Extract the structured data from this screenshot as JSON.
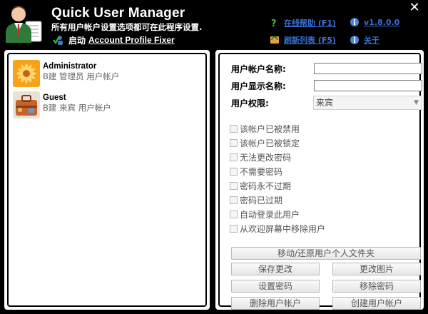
{
  "header": {
    "title": "Quick User Manager",
    "subtitle": "所有用户帐户设置选项都可在此程序设置.",
    "startup_label": "启动",
    "startup_link": "Account Profile Fixer",
    "links": {
      "help": "在线帮助 (F1)",
      "version": "v1.8.0.0",
      "refresh": "刷新列表 (F5)",
      "about": "关于"
    },
    "close": "✕"
  },
  "users": [
    {
      "name": "Administrator",
      "desc": "B建 管理员 用户帐户",
      "avatar": "flower-icon"
    },
    {
      "name": "Guest",
      "desc": "B建 来宾 用户帐户",
      "avatar": "briefcase-icon"
    }
  ],
  "form": {
    "account_name_label": "用户帐户名称:",
    "account_name_value": "",
    "display_name_label": "用户显示名称:",
    "display_name_value": "",
    "permission_label": "用户权限:",
    "permission_value": "来宾"
  },
  "checkboxes": [
    "该帐户已被禁用",
    "该帐户已被锁定",
    "无法更改密码",
    "不需要密码",
    "密码永不过期",
    "密码已过期",
    "自动登录此用户",
    "从欢迎屏幕中移除用户"
  ],
  "buttons": {
    "move_restore": "移动/还原用户个人文件夹",
    "save": "保存更改",
    "change_picture": "更改图片",
    "set_password": "设置密码",
    "remove_password": "移除密码",
    "delete_account": "删除用户帐户",
    "create_account": "创建用户帐户"
  },
  "colors": {
    "background": "#000000",
    "link": "#3a6fd8",
    "panel": "#ffffff"
  }
}
